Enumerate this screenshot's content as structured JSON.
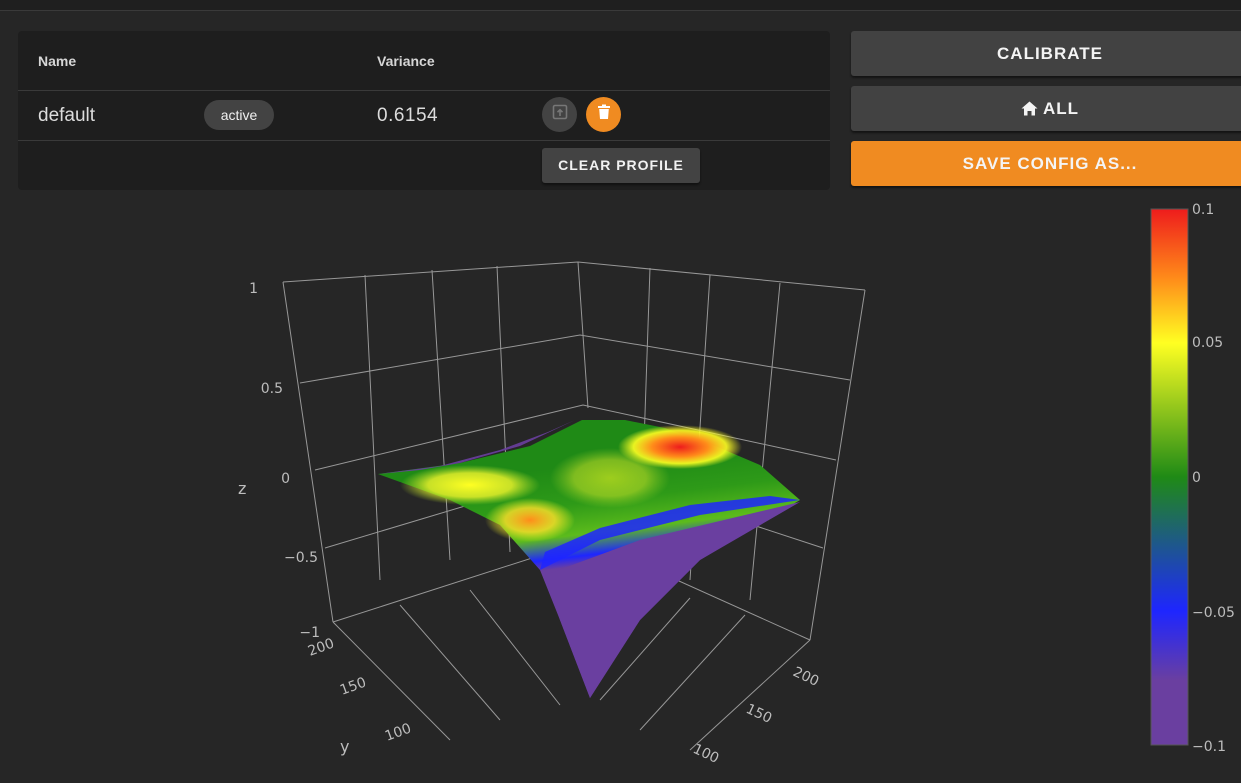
{
  "profiles": {
    "columns": {
      "name": "Name",
      "variance": "Variance"
    },
    "rows": [
      {
        "name": "default",
        "status": "active",
        "variance": "0.6154"
      }
    ],
    "clear_label": "CLEAR PROFILE"
  },
  "actions": {
    "calibrate": "CALIBRATE",
    "home_all": "ALL",
    "save_config": "SAVE CONFIG AS..."
  },
  "icons": {
    "home": "home-icon",
    "load": "upload-icon",
    "delete": "trash-icon"
  },
  "colors": {
    "accent": "#f08b21",
    "button": "#424242",
    "background": "#262626"
  },
  "chart_data": {
    "type": "surface",
    "title": "",
    "zlabel": "z",
    "ylabel": "y",
    "xlabel": "",
    "z_ticks": [
      "1",
      "0.5",
      "0",
      "−0.5",
      "−1"
    ],
    "y_ticks": [
      "200",
      "150",
      "100"
    ],
    "x_ticks": [
      "200",
      "150",
      "100"
    ],
    "zlim": [
      -1,
      1
    ],
    "colorbar": {
      "range": [
        -0.1,
        0.1
      ],
      "ticks": [
        "0.1",
        "0.05",
        "0",
        "−0.05",
        "−0.1"
      ],
      "colorscale": [
        "#6a3fa0",
        "#1e26ff",
        "#1f8a16",
        "#ffff22",
        "#ee1c1c"
      ]
    }
  }
}
